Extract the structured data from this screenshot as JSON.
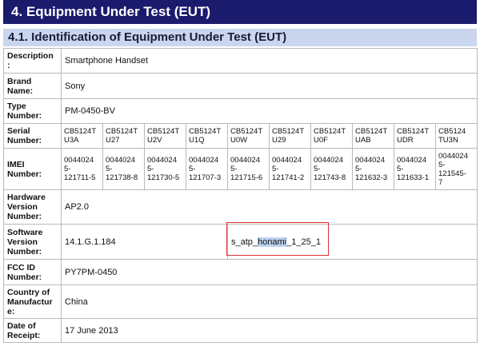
{
  "heading": "4. Equipment Under Test (EUT)",
  "subheading": "4.1. Identification of Equipment Under Test (EUT)",
  "rows": {
    "description": {
      "label": "Description\n:",
      "value": "Smartphone Handset"
    },
    "brand": {
      "label": "Brand\nName:",
      "value": "Sony"
    },
    "type": {
      "label": "Type\nNumber:",
      "value": "PM-0450-BV"
    },
    "serial": {
      "label": "Serial\nNumber:",
      "values": [
        "CB5124T\nU3A",
        "CB5124T\nU27",
        "CB5124T\nU2V",
        "CB5124T\nU1Q",
        "CB5124T\nU0W",
        "CB5124T\nU29",
        "CB5124T\nU0F",
        "CB5124T\nUAB",
        "CB5124T\nUDR",
        "CB5124\nTU3N"
      ]
    },
    "imei": {
      "label": "IMEI\nNumber:",
      "values": [
        "0044024\n5-\n121711-5",
        "0044024\n5-\n121738-8",
        "0044024\n5-\n121730-5",
        "0044024\n5-\n121707-3",
        "0044024\n5-\n121715-6",
        "0044024\n5-\n121741-2",
        "0044024\n5-\n121743-8",
        "0044024\n5-\n121632-3",
        "0044024\n5-\n121633-1",
        "0044024\n5-\n121545-\n7"
      ]
    },
    "hardware": {
      "label": "Hardware\nVersion\nNumber:",
      "value": "AP2.0"
    },
    "software": {
      "label": "Software\nVersion\nNumber:",
      "value": "14.1.G.1.184",
      "build_prefix": "s_atp_",
      "build_highlight": "honami",
      "build_suffix": "_1_25_1"
    },
    "fcc": {
      "label": "FCC ID\nNumber:",
      "value": "PY7PM-0450"
    },
    "country": {
      "label": "Country of\nManufactur\ne:",
      "value": "China"
    },
    "date": {
      "label": "Date of\nReceipt:",
      "value": "17 June 2013"
    }
  },
  "colors": {
    "heading_bg": "#1b1b6e",
    "subheading_bg": "#c9d6ee",
    "highlight": "#bcd2f0",
    "annotation_box": "#d93030"
  }
}
